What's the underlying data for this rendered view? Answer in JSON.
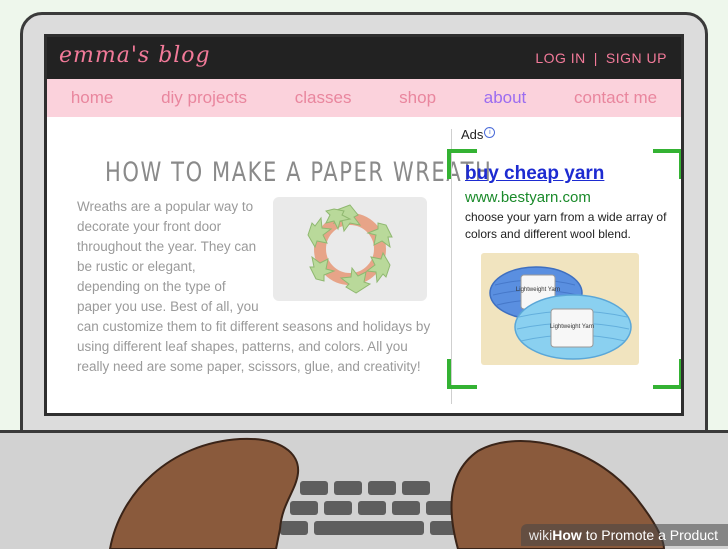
{
  "blog": {
    "logo": "emma's blog",
    "login": "LOG IN",
    "separator": "|",
    "signup": "SIGN UP"
  },
  "nav": {
    "items": [
      {
        "label": "home"
      },
      {
        "label": "diy projects"
      },
      {
        "label": "classes"
      },
      {
        "label": "shop"
      },
      {
        "label": "about"
      },
      {
        "label": "contact me"
      }
    ],
    "active": "about"
  },
  "article": {
    "title": "HOW TO MAKE A PAPER WREATH",
    "body": "Wreaths are a popular way to decorate your front door throughout the year. They can be rustic or elegant, depending on the type of paper you use. Best of all, you can customize them to fit different seasons and holidays by using different leaf shapes, patterns, and colors. All you really need are some paper, scissors, glue, and creativity!"
  },
  "ad": {
    "label": "Ads",
    "info_icon": "info-icon",
    "headline": "buy cheap yarn",
    "url": "www.bestyarn.com",
    "description": "choose your yarn from a wide array of colors and different wool blend.",
    "yarn_label_1": "Lightweight Yarn",
    "yarn_label_2": "Lightweight Yarn"
  },
  "watermark": {
    "wiki": "wiki",
    "how": "How",
    "rest": "to Promote a Product"
  },
  "colors": {
    "topbar": "#222222",
    "pink_text": "#f27a99",
    "nav_bg": "#fbd2dc",
    "nav_active": "#9b6cf0",
    "ad_frame": "#34b233",
    "ad_headline": "#1d2bd1",
    "ad_url": "#1a8a2a"
  }
}
